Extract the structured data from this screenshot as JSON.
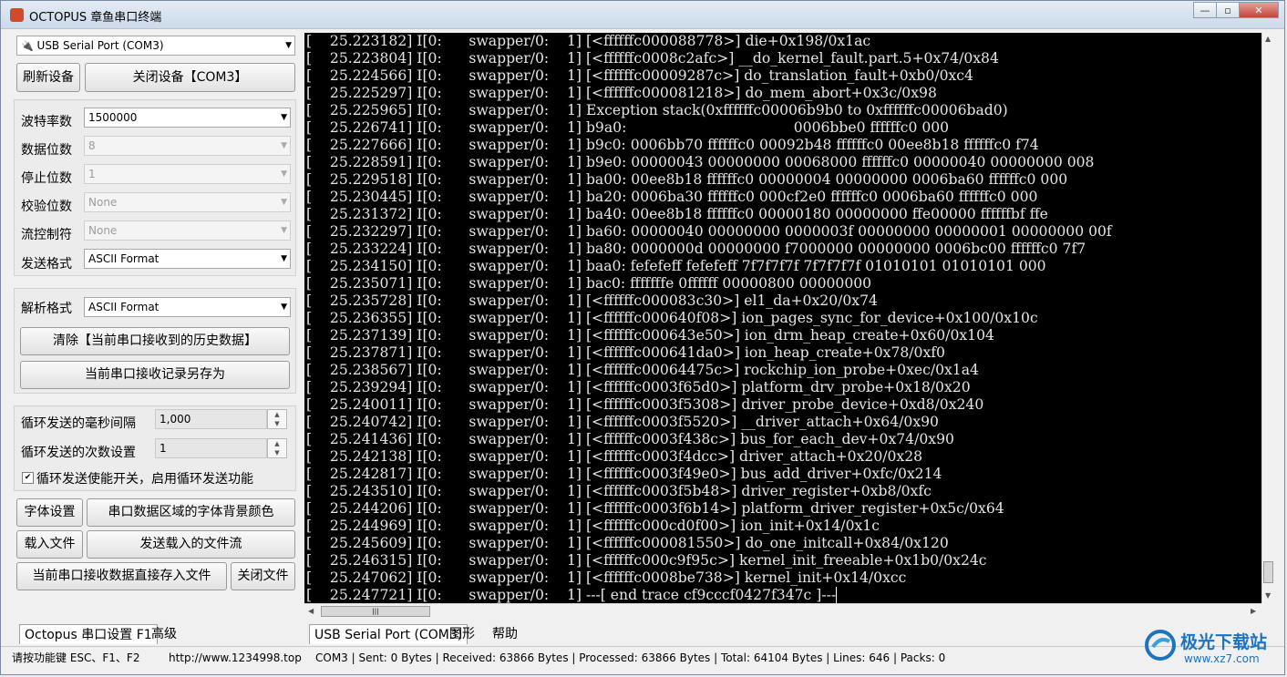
{
  "window": {
    "title": "OCTOPUS 章鱼串口终端",
    "minimize": "—",
    "restore": "▫",
    "close": "✕"
  },
  "left_panel": {
    "port_select": "USB Serial Port (COM3)",
    "refresh_button": "刷新设备",
    "close_device_button": "关闭设备【COM3】",
    "baud_label": "波特率数",
    "baud_value": "1500000",
    "databits_label": "数据位数",
    "databits_value": "8",
    "stopbits_label": "停止位数",
    "stopbits_value": "1",
    "parity_label": "校验位数",
    "parity_value": "None",
    "flow_label": "流控制符",
    "flow_value": "None",
    "send_format_label": "发送格式",
    "send_format_value": "ASCII Format",
    "parse_format_label": "解析格式",
    "parse_format_value": "ASCII Format",
    "clear_button": "清除【当前串口接收到的历史数据】",
    "save_as_button": "当前串口接收记录另存为",
    "interval_label": "循环发送的毫秒间隔",
    "interval_value": "1,000",
    "count_label": "循环发送的次数设置",
    "count_value": "1",
    "loop_checkbox_label": "循环发送使能开关，启用循环发送功能",
    "loop_checked": true,
    "font_button": "字体设置",
    "bg_color_button": "串口数据区域的字体背景颜色",
    "load_file_button": "载入文件",
    "send_file_button": "发送载入的文件流",
    "save_direct_button": "当前串口接收数据直接存入文件",
    "close_file_button": "关闭文件"
  },
  "terminal": {
    "lines": [
      "[    25.223182] I[0:      swapper/0:    1] [<ffffffc000088778>] die+0x198/0x1ac",
      "[    25.223804] I[0:      swapper/0:    1] [<ffffffc0008c2afc>] __do_kernel_fault.part.5+0x74/0x84",
      "[    25.224566] I[0:      swapper/0:    1] [<ffffffc00009287c>] do_translation_fault+0xb0/0xc4",
      "[    25.225297] I[0:      swapper/0:    1] [<ffffffc000081218>] do_mem_abort+0x3c/0x98",
      "[    25.225965] I[0:      swapper/0:    1] Exception stack(0xffffffc00006b9b0 to 0xffffffc00006bad0)",
      "[    25.226741] I[0:      swapper/0:    1] b9a0:                                     0006bbe0 ffffffc0 000",
      "[    25.227666] I[0:      swapper/0:    1] b9c0: 0006bb70 ffffffc0 00092b48 ffffffc0 00ee8b18 ffffffc0 f74",
      "[    25.228591] I[0:      swapper/0:    1] b9e0: 00000043 00000000 00068000 ffffffc0 00000040 00000000 008",
      "[    25.229518] I[0:      swapper/0:    1] ba00: 00ee8b18 ffffffc0 00000004 00000000 0006ba60 ffffffc0 000",
      "[    25.230445] I[0:      swapper/0:    1] ba20: 0006ba30 ffffffc0 000cf2e0 ffffffc0 0006ba60 ffffffc0 000",
      "[    25.231372] I[0:      swapper/0:    1] ba40: 00ee8b18 ffffffc0 00000180 00000000 ffe00000 ffffffbf ffe",
      "[    25.232297] I[0:      swapper/0:    1] ba60: 00000040 00000000 0000003f 00000000 00000001 00000000 00f",
      "[    25.233224] I[0:      swapper/0:    1] ba80: 0000000d 00000000 f7000000 00000000 0006bc00 ffffffc0 7f7",
      "[    25.234150] I[0:      swapper/0:    1] baa0: fefefeff fefefeff 7f7f7f7f 7f7f7f7f 01010101 01010101 000",
      "[    25.235071] I[0:      swapper/0:    1] bac0: fffffffe 0ffffff 00000800 00000000",
      "[    25.235728] I[0:      swapper/0:    1] [<ffffffc000083c30>] el1_da+0x20/0x74",
      "[    25.236355] I[0:      swapper/0:    1] [<ffffffc000640f08>] ion_pages_sync_for_device+0x100/0x10c",
      "[    25.237139] I[0:      swapper/0:    1] [<ffffffc000643e50>] ion_drm_heap_create+0x60/0x104",
      "[    25.237871] I[0:      swapper/0:    1] [<ffffffc000641da0>] ion_heap_create+0x78/0xf0",
      "[    25.238567] I[0:      swapper/0:    1] [<ffffffc00064475c>] rockchip_ion_probe+0xec/0x1a4",
      "[    25.239294] I[0:      swapper/0:    1] [<ffffffc0003f65d0>] platform_drv_probe+0x18/0x20",
      "[    25.240011] I[0:      swapper/0:    1] [<ffffffc0003f5308>] driver_probe_device+0xd8/0x240",
      "[    25.240742] I[0:      swapper/0:    1] [<ffffffc0003f5520>] __driver_attach+0x64/0x90",
      "[    25.241436] I[0:      swapper/0:    1] [<ffffffc0003f438c>] bus_for_each_dev+0x74/0x90",
      "[    25.242138] I[0:      swapper/0:    1] [<ffffffc0003f4dcc>] driver_attach+0x20/0x28",
      "[    25.242817] I[0:      swapper/0:    1] [<ffffffc0003f49e0>] bus_add_driver+0xfc/0x214",
      "[    25.243510] I[0:      swapper/0:    1] [<ffffffc0003f5b48>] driver_register+0xb8/0xfc",
      "[    25.244206] I[0:      swapper/0:    1] [<ffffffc0003f6b14>] platform_driver_register+0x5c/0x64",
      "[    25.244969] I[0:      swapper/0:    1] [<ffffffc000cd0f00>] ion_init+0x14/0x1c",
      "[    25.245609] I[0:      swapper/0:    1] [<ffffffc000081550>] do_one_initcall+0x84/0x120",
      "[    25.246315] I[0:      swapper/0:    1] [<ffffffc000c9f95c>] kernel_init_freeable+0x1b0/0x24c",
      "[    25.247062] I[0:      swapper/0:    1] [<ffffffc0008be738>] kernel_init+0x14/0xcc",
      "[    25.247721] I[0:      swapper/0:    1] ---[ end trace cf9cccf0427f347c ]---"
    ]
  },
  "bottom_tabs": {
    "left_tab1": "Octopus 串口设置 F1",
    "left_tab2": "高级",
    "right_tab1": "USB Serial Port (COM3)",
    "right_tab2": "图形",
    "right_tab3": "帮助"
  },
  "status_bar": {
    "hint": "请按功能键 ESC、F1、F2",
    "url": "http://www.1234998.top",
    "stats": "COM3 | Sent: 0 Bytes | Received: 63866 Bytes | Processed: 63866 Bytes | Total: 64104 Bytes | Lines: 646 | Packs: 0"
  },
  "watermark": {
    "text": "极光下载站",
    "url": "www.xz7.com"
  },
  "colors": {
    "terminal_bg": "#000000",
    "terminal_fg": "#e6e6e6",
    "watermark_blue": "#1e73be"
  }
}
